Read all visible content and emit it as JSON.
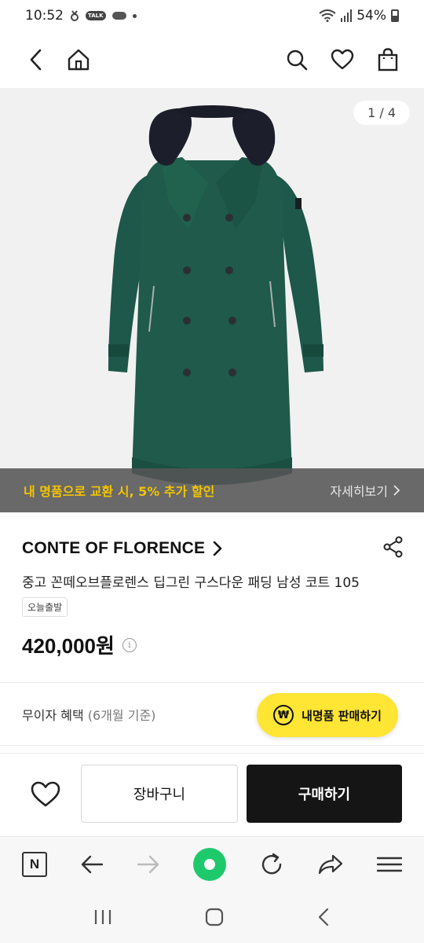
{
  "status_bar": {
    "time": "10:52",
    "talk_badge": "TALK",
    "battery_percent": "54%"
  },
  "top_nav": {
    "back_icon": "chevron-left-icon",
    "home_icon": "home-icon",
    "search_icon": "search-icon",
    "wishlist_icon": "heart-icon",
    "bag_icon": "shopping-bag-icon"
  },
  "gallery": {
    "page_indicator": "1 / 4",
    "current_page": 1,
    "total_pages": 4
  },
  "promo": {
    "text": "내 명품으로 교환 시, 5% 추가 할인",
    "link_label": "자세히보기"
  },
  "product": {
    "brand": "CONTE OF FLORENCE",
    "title": "중고 꼰떼오브플로렌스 딥그린 구스다운 패딩 남성 코트 105",
    "shipping_badge": "오늘출발",
    "price": "420,000원"
  },
  "installment": {
    "label": "무이자 혜택",
    "sub": "(6개월 기준)"
  },
  "sell_button": {
    "icon_glyph": "₩",
    "label": "내명품 판매하기"
  },
  "actions": {
    "cart_label": "장바구니",
    "buy_label": "구매하기"
  },
  "browser": {
    "n_label": "N"
  },
  "colors": {
    "promo_text": "#f2c400",
    "sell_button": "#ffe534",
    "buy_button": "#151515",
    "coat_green": "#1f5a4a",
    "browser_green": "#1ec96b"
  }
}
